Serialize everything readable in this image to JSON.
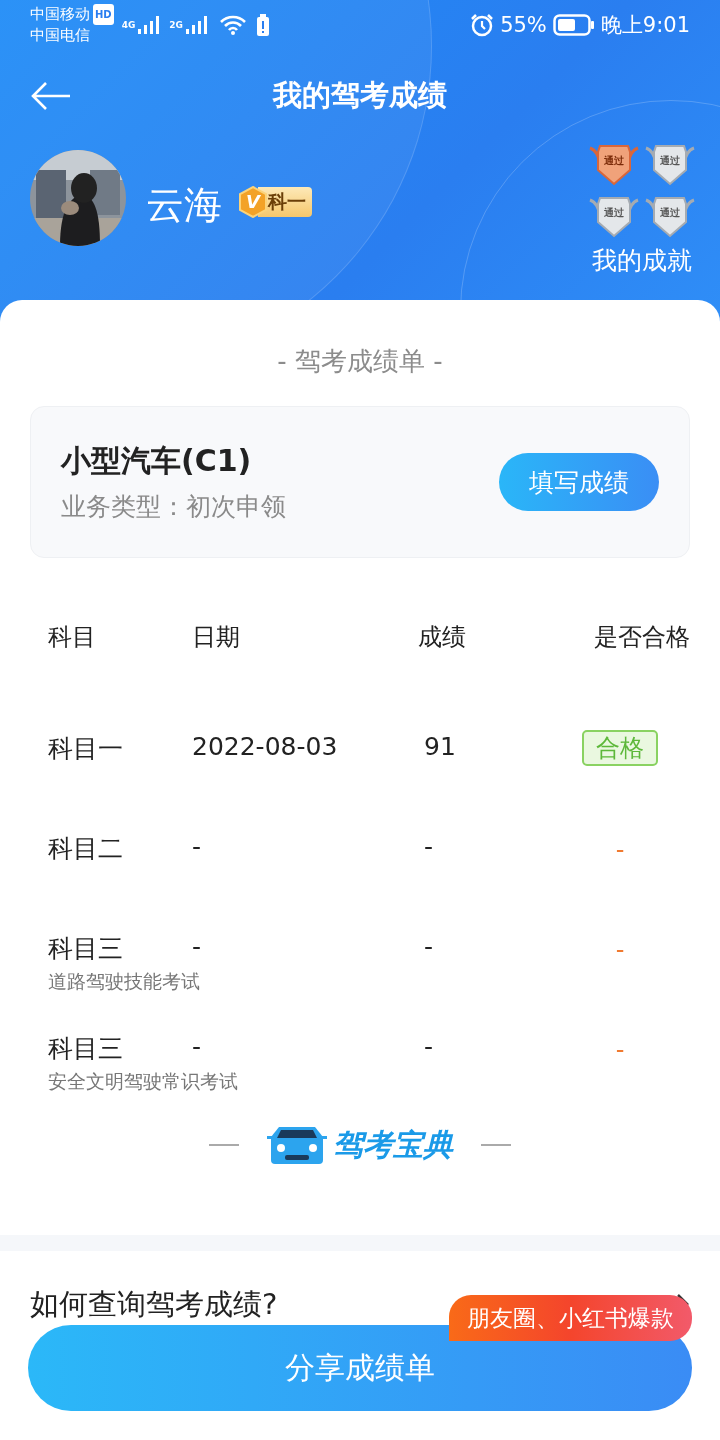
{
  "status_bar": {
    "carrier_1": "中国移动",
    "hd": "HD",
    "carrier_2": "中国电信",
    "net_1": "4G",
    "net_2": "2G",
    "battery": "55%",
    "time": "晚上9:01"
  },
  "header": {
    "title": "我的驾考成绩",
    "user_name": "云海",
    "level_badge": {
      "letter": "V",
      "label": "科一"
    },
    "achievements": {
      "label": "我的成就",
      "medals": [
        {
          "text": "通过",
          "earned": true
        },
        {
          "text": "通过",
          "earned": false
        },
        {
          "text": "通过",
          "earned": false
        },
        {
          "text": "通过",
          "earned": false
        }
      ]
    }
  },
  "sheet": {
    "heading": "- 驾考成绩单 -",
    "license": {
      "name": "小型汽车(C1)",
      "business_type": "业务类型：初次申领",
      "button": "填写成绩"
    },
    "table": {
      "columns": [
        "科目",
        "日期",
        "成绩",
        "是否合格"
      ],
      "rows": [
        {
          "subject": "科目一",
          "date": "2022-08-03",
          "score": "91",
          "result": {
            "kind": "pass",
            "text": "合格"
          }
        },
        {
          "subject": "科目二",
          "date": "-",
          "score": "-",
          "result": {
            "kind": "pending",
            "text": "-"
          }
        },
        {
          "subject": "科目三",
          "subtitle": "道路驾驶技能考试",
          "date": "-",
          "score": "-",
          "result": {
            "kind": "pending",
            "text": "-"
          }
        },
        {
          "subject": "科目三",
          "subtitle": "安全文明驾驶常识考试",
          "date": "-",
          "score": "-",
          "result": {
            "kind": "pending",
            "text": "-"
          }
        }
      ]
    },
    "logo": "驾考宝典"
  },
  "faq": {
    "question": "如何查询驾考成绩?"
  },
  "share": {
    "button": "分享成绩单",
    "tag": "朋友圈、小红书爆款"
  }
}
